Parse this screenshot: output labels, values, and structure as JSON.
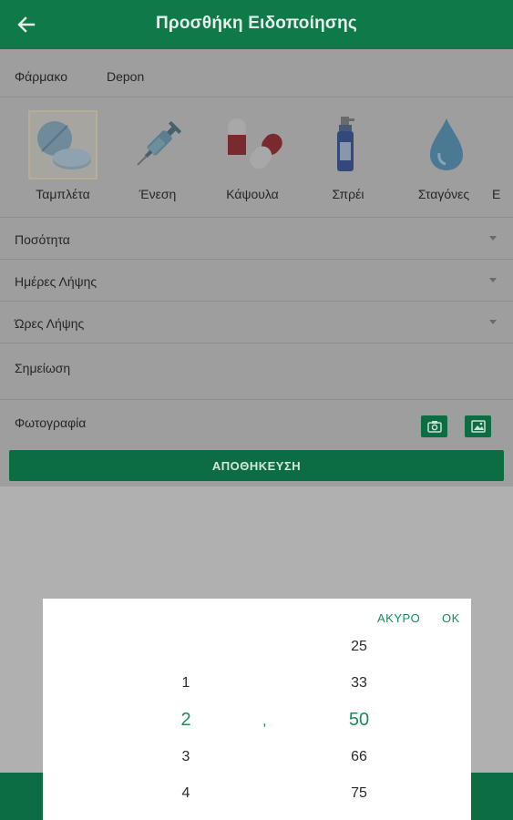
{
  "appbar": {
    "title": "Προσθήκη Ειδοποίησης",
    "back_icon": "arrow-left-icon"
  },
  "form": {
    "drug_label": "Φάρμακο",
    "drug_value": "Depon",
    "types": [
      {
        "label": "Ταμπλέτα",
        "icon": "tablet-icon",
        "selected": true
      },
      {
        "label": "Ένεση",
        "icon": "syringe-icon",
        "selected": false
      },
      {
        "label": "Κάψουλα",
        "icon": "capsule-icon",
        "selected": false
      },
      {
        "label": "Σπρέι",
        "icon": "spray-icon",
        "selected": false
      },
      {
        "label": "Σταγόνες",
        "icon": "drops-icon",
        "selected": false
      },
      {
        "label": "Ε",
        "icon": "",
        "selected": false
      }
    ],
    "quantity_label": "Ποσότητα",
    "days_label": "Ημέρες Λήψης",
    "hours_label": "Ώρες Λήψης",
    "note_label": "Σημείωση",
    "photo_label": "Φωτογραφία",
    "save_label": "ΑΠΟΘΗΚΕΥΣΗ"
  },
  "dialog": {
    "cancel_label": "ΑΚΥΡΟ",
    "ok_label": "OK",
    "integer_column": [
      "1",
      "2",
      "3",
      "4"
    ],
    "integer_selected": "2",
    "separator": ",",
    "fraction_column": [
      "25",
      "33",
      "50",
      "66",
      "75"
    ],
    "fraction_selected": "50"
  },
  "colors": {
    "primary": "#0e7a4a",
    "accent": "#1a8c59",
    "scrim": "#9e9e9e"
  }
}
